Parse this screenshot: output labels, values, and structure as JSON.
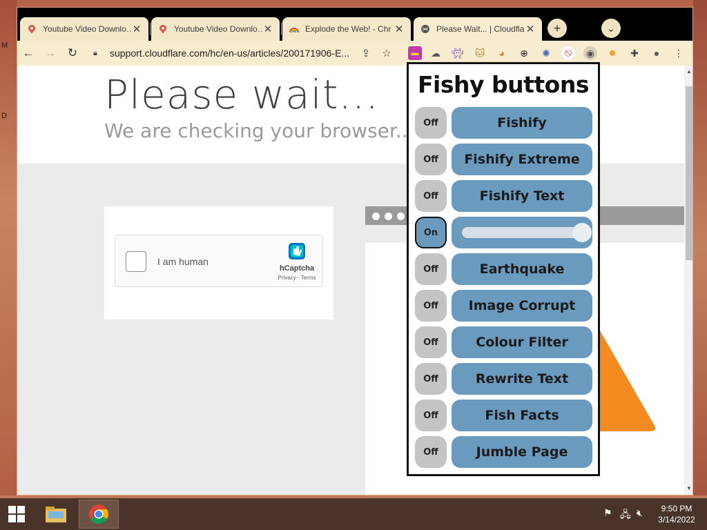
{
  "desktop": {
    "glyphs": [
      "M",
      "D"
    ]
  },
  "tabs": [
    {
      "title": "Youtube Video Downlo…",
      "favicon": "pin-icon",
      "active": false
    },
    {
      "title": "Youtube Video Downlo…",
      "favicon": "pin-icon",
      "active": false
    },
    {
      "title": "Explode the Web! - Chr",
      "favicon": "rainbow-icon",
      "active": false
    },
    {
      "title": "Please Wait... | Cloudfla",
      "favicon": "globe-icon",
      "active": true
    }
  ],
  "tabstrip": {
    "new_tab": "+",
    "tab_search": "⌄"
  },
  "toolbar": {
    "url": "support.cloudflare.com/hc/en-us/articles/200171906-E...",
    "back": "←",
    "forward": "→",
    "reload": "↻"
  },
  "page": {
    "heading": "Please wait...",
    "subheading": "We are checking your browser... sup",
    "captcha_label": "I am human",
    "captcha_brand": "hCaptcha",
    "captcha_links": "Privacy - Terms"
  },
  "popup": {
    "title": "Fishy buttons",
    "rows": [
      {
        "toggle": "Off",
        "label": "Fishify",
        "on": false
      },
      {
        "toggle": "Off",
        "label": "Fishify Extreme",
        "on": false
      },
      {
        "toggle": "Off",
        "label": "Fishify Text",
        "on": false
      },
      {
        "toggle": "On",
        "label": "",
        "on": true,
        "slider": 1.0
      },
      {
        "toggle": "Off",
        "label": "Earthquake",
        "on": false
      },
      {
        "toggle": "Off",
        "label": "Image Corrupt",
        "on": false
      },
      {
        "toggle": "Off",
        "label": "Colour Filter",
        "on": false
      },
      {
        "toggle": "Off",
        "label": "Rewrite Text",
        "on": false
      },
      {
        "toggle": "Off",
        "label": "Fish Facts",
        "on": false
      },
      {
        "toggle": "Off",
        "label": "Jumble Page",
        "on": false
      }
    ]
  },
  "taskbar": {
    "time": "9:50 PM",
    "date": "3/14/2022"
  },
  "colors": {
    "accent_blue": "#6b9abf",
    "toggle_off": "#c4c4c4",
    "chrome_tab": "#f3e8c9",
    "orange_shape": "#f38b20"
  }
}
